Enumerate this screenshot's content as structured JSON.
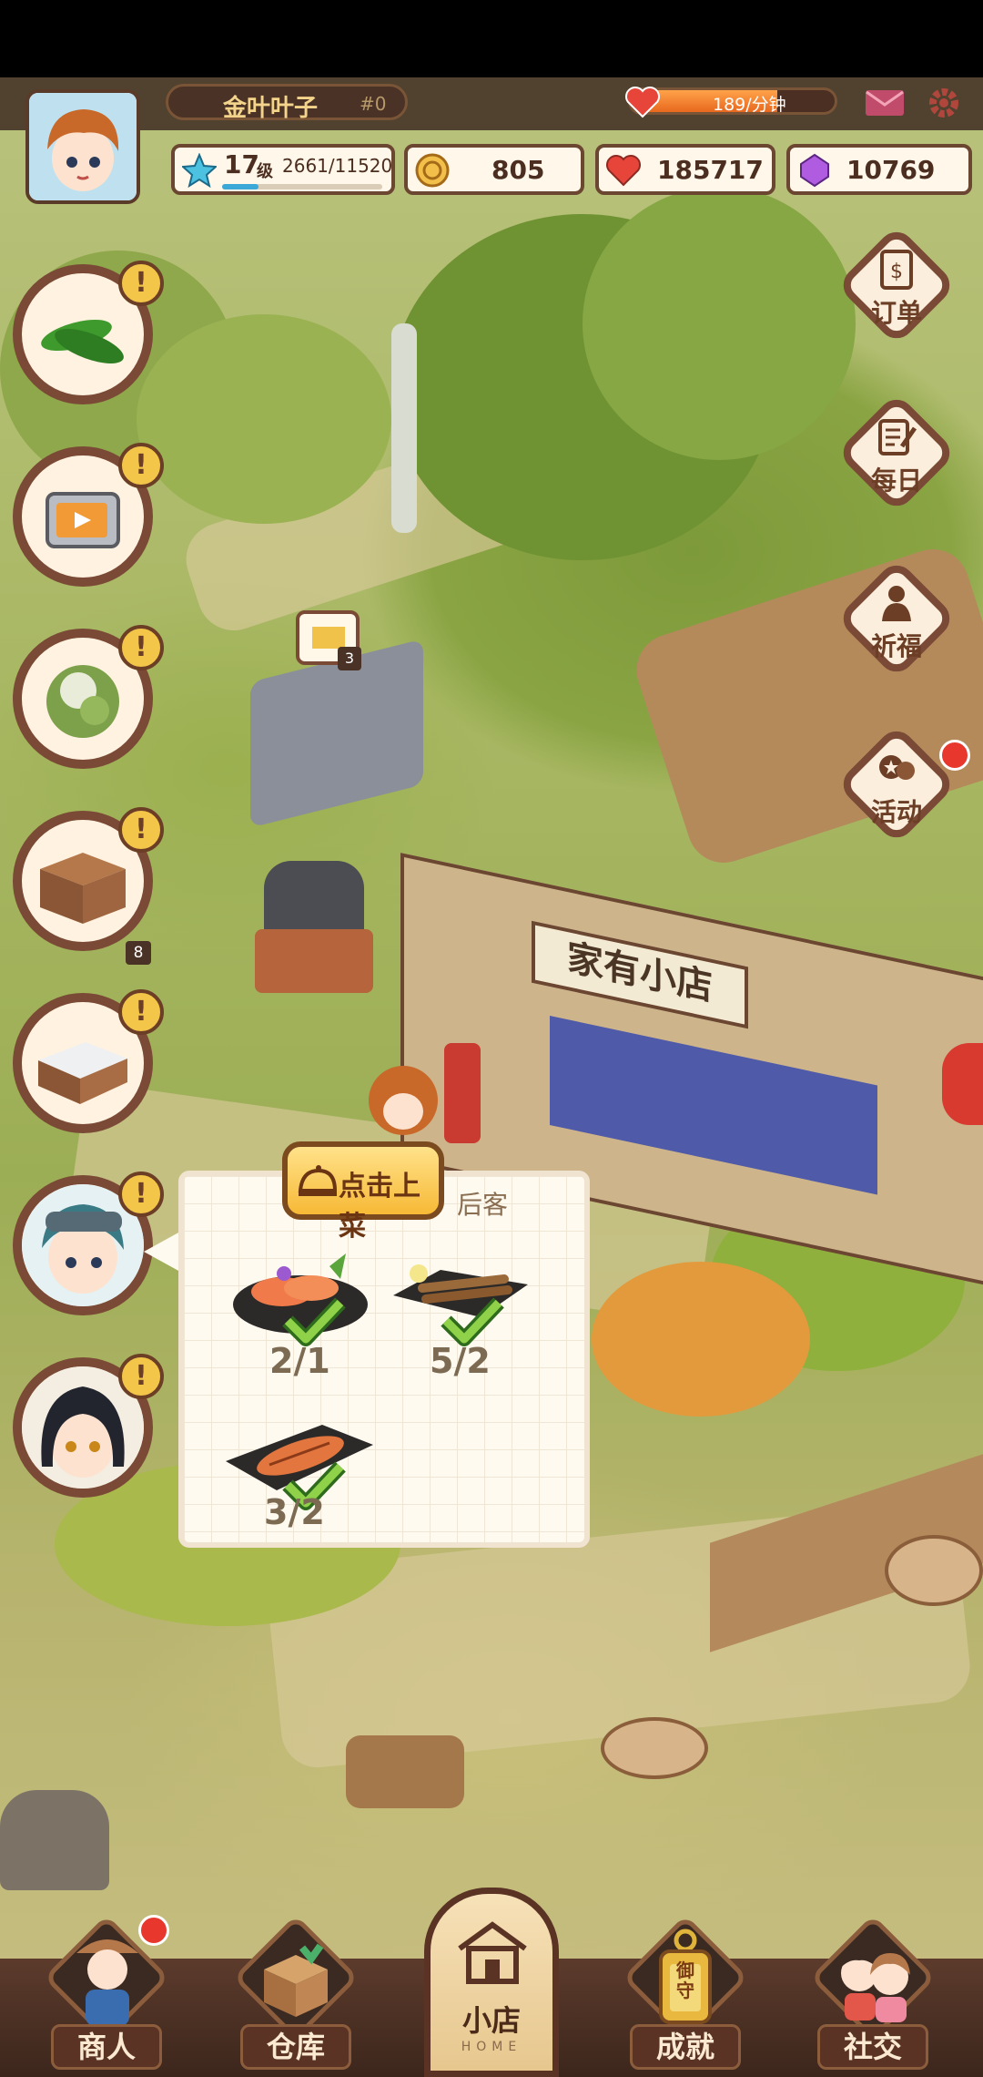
{
  "player": {
    "name": "金叶叶子",
    "id_tag": "#0",
    "avatar": "boy-chef-avatar",
    "level": "17",
    "level_unit": "级",
    "exp": "2661/11520",
    "exp_fraction": 0.23
  },
  "rate": {
    "label": "189/分钟",
    "fill_fraction": 0.72
  },
  "currencies": {
    "coins": "805",
    "hearts": "185717",
    "gems": "10769"
  },
  "right_menu": [
    {
      "label": "订单",
      "icon": "order-book-icon"
    },
    {
      "label": "每日",
      "icon": "daily-checklist-icon"
    },
    {
      "label": "祈福",
      "icon": "buddha-icon"
    },
    {
      "label": "活动",
      "icon": "event-gift-icon",
      "has_dot": true
    }
  ],
  "left_menu": [
    {
      "icon": "cucumber-icon"
    },
    {
      "icon": "tv-ad-icon"
    },
    {
      "icon": "cabbage-icon"
    },
    {
      "icon": "wooden-table-icon"
    },
    {
      "icon": "bed-icon"
    },
    {
      "icon": "customer-boy-avatar"
    },
    {
      "icon": "customer-girl-avatar"
    }
  ],
  "alert_mark": "!",
  "map": {
    "sign_text": "家有小店",
    "crate_badge": "3",
    "stall_badge": "8"
  },
  "popup": {
    "serve_button": "点击上菜",
    "title_fragment": "后客",
    "dishes": [
      {
        "icon": "sashimi-dish-icon",
        "count": "2/1"
      },
      {
        "icon": "grilled-fish-icon",
        "count": "5/2"
      },
      {
        "icon": "grilled-squid-icon",
        "count": "3/2"
      }
    ]
  },
  "bottom_nav": [
    {
      "label": "商人",
      "icon": "merchant-icon",
      "has_dot": true
    },
    {
      "label": "仓库",
      "icon": "warehouse-icon"
    },
    {
      "label": "小店",
      "sub": "HOME",
      "icon": "shop-home-icon"
    },
    {
      "label": "成就",
      "icon": "achievement-icon",
      "badge": "御守"
    },
    {
      "label": "社交",
      "icon": "social-icon"
    }
  ],
  "colors": {
    "frame_brown": "#7a4a36",
    "alert_yellow": "#f3c64a",
    "bar_orange": "#f08a24",
    "notify_red": "#e8382e"
  }
}
